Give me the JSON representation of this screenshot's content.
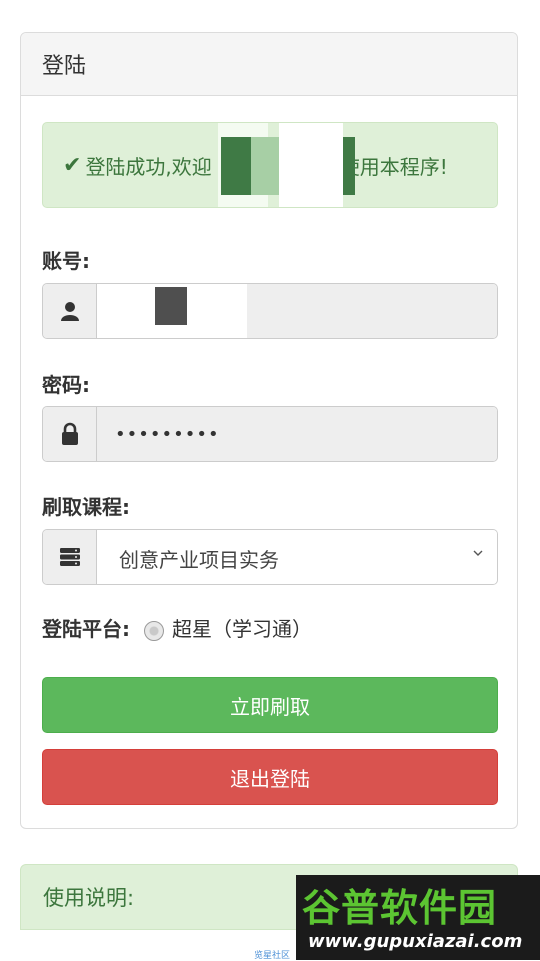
{
  "panel": {
    "title": "登陆"
  },
  "alert": {
    "prefix": "登陆成功,欢迎",
    "suffix": "使用本程序!"
  },
  "account": {
    "label": "账号:"
  },
  "password": {
    "label": "密码:",
    "value": "•••••••••"
  },
  "course": {
    "label": "刷取课程:",
    "selected": "创意产业项目实务"
  },
  "platform": {
    "label": "登陆平台:",
    "option": "超星（学习通）"
  },
  "buttons": {
    "start": "立即刷取",
    "logout": "退出登陆"
  },
  "instructions": {
    "title": "使用说明:"
  },
  "footer": {
    "text": "览星社区"
  },
  "watermark": {
    "title": "谷普软件园",
    "url": "www.gupuxiazai.com"
  },
  "colors": {
    "success_bg": "#dff0d8",
    "success_text": "#3c763d",
    "primary_green": "#5cb85c",
    "danger_red": "#d9534f"
  },
  "icons": {
    "alert": "check-icon",
    "account": "user-icon",
    "password": "lock-icon",
    "course": "server-icon",
    "select": "chevron-down-icon"
  }
}
